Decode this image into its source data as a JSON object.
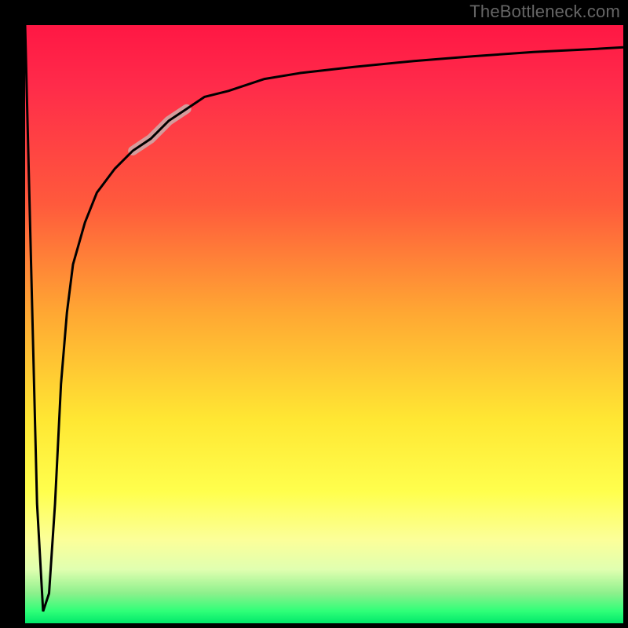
{
  "watermark": "TheBottleneck.com",
  "chart_data": {
    "type": "line",
    "title": "",
    "xlabel": "",
    "ylabel": "",
    "xlim": [
      0,
      100
    ],
    "ylim": [
      0,
      100
    ],
    "grid": false,
    "series": [
      {
        "name": "curve",
        "x": [
          0,
          1,
          2,
          3,
          4,
          5,
          6,
          7,
          8,
          10,
          12,
          15,
          18,
          21,
          24,
          27,
          30,
          34,
          40,
          46,
          55,
          65,
          75,
          85,
          95,
          100
        ],
        "y": [
          100,
          60,
          20,
          2,
          5,
          20,
          40,
          52,
          60,
          67,
          72,
          76,
          79,
          81,
          84,
          86,
          88,
          89,
          91,
          92,
          93,
          94,
          94.8,
          95.5,
          96,
          96.3
        ]
      }
    ],
    "highlight": {
      "x_range": [
        18,
        27
      ],
      "color": "#d49c9c"
    },
    "gradient_stops": [
      {
        "pos": 0,
        "color": "#ff1744"
      },
      {
        "pos": 30,
        "color": "#ff5a3c"
      },
      {
        "pos": 48,
        "color": "#ffa733"
      },
      {
        "pos": 66,
        "color": "#ffe733"
      },
      {
        "pos": 86,
        "color": "#fcff99"
      },
      {
        "pos": 95,
        "color": "#8cf08c"
      },
      {
        "pos": 100,
        "color": "#00e76a"
      }
    ]
  }
}
